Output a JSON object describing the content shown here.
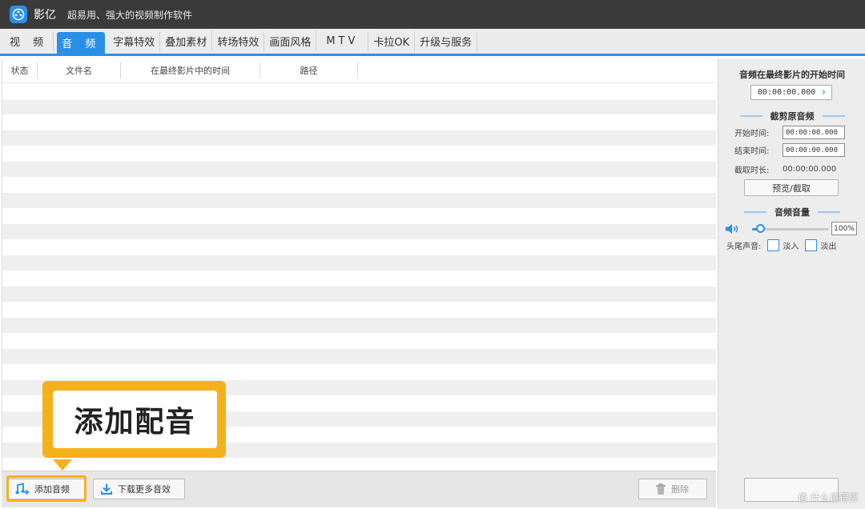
{
  "titlebar": {
    "app_name": "影亿",
    "slogan": "超易用、强大的视频制作软件"
  },
  "tabs": [
    {
      "label": "视 频",
      "active": false
    },
    {
      "label": "音 频",
      "active": true
    },
    {
      "label": "字幕特效",
      "active": false
    },
    {
      "label": "叠加素材",
      "active": false
    },
    {
      "label": "转场特效",
      "active": false
    },
    {
      "label": "画面风格",
      "active": false
    },
    {
      "label": "MTV",
      "active": false
    },
    {
      "label": "卡拉OK",
      "active": false
    },
    {
      "label": "升级与服务",
      "active": false
    }
  ],
  "list": {
    "columns": [
      "状态",
      "文件名",
      "在最终影片中的时间",
      "路径"
    ]
  },
  "bottom": {
    "add_audio_label": "添加音频",
    "download_more_label": "下载更多音效",
    "delete_label": "删除"
  },
  "callout": {
    "text": "添加配音"
  },
  "side": {
    "start_time_title": "音频在最终影片的开始时间",
    "start_time_value": "00:00:00.000",
    "trim_section": "截剪原音频",
    "start_label": "开始时间:",
    "start_value": "00:00:00.000",
    "end_label": "结束时间:",
    "end_value": "00:00:00.000",
    "duration_label": "截取时长:",
    "duration_value": "00:00:00.000",
    "preview_button": "预览/截取",
    "volume_section": "音频音量",
    "volume_percent": "100%",
    "volume_level_fraction": 0.1,
    "fade_label": "头尾声音:",
    "fade_in_label": "淡入",
    "fade_out_label": "淡出"
  },
  "watermark": "值 什么值得买",
  "colors": {
    "accent": "#2a8fe6",
    "callout": "#f5b11c",
    "titlebar": "#3a3a3a"
  }
}
